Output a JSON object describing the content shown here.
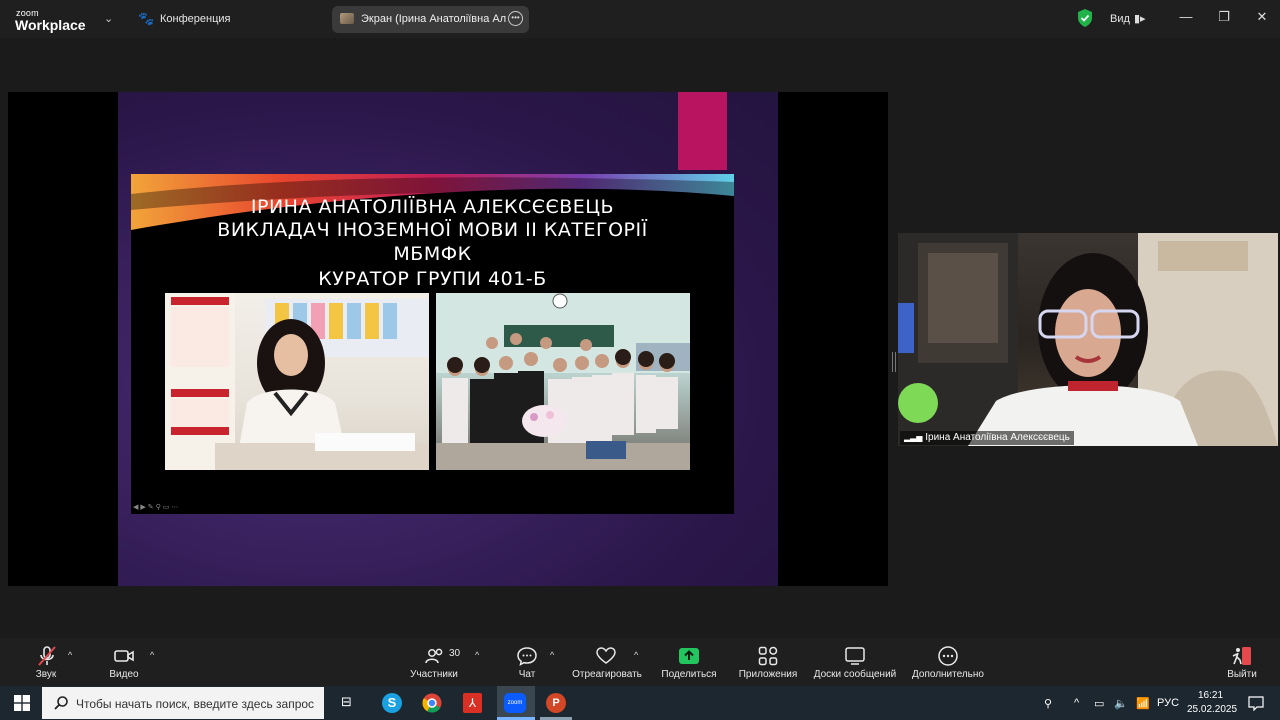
{
  "app": {
    "logo_small": "zoom",
    "logo_big": "Workplace",
    "meeting_menu": "Конференция"
  },
  "share_pill": {
    "label": "Экран (Ірина Анатоліївна Алек"
  },
  "top_right": {
    "view_label": "Вид",
    "shield_color": "#21b34a"
  },
  "slide": {
    "line1": "ІРИНА АНАТОЛІЇВНА АЛЕКСЄЄВЕЦЬ",
    "line2": "ВИКЛАДАЧ ІНОЗЕМНОЇ МОВИ ІІ КАТЕГОРІЇ",
    "line3": "МБМФК",
    "line4": "КУРАТОР ГРУПИ 401-Б",
    "accent": "#b8145f"
  },
  "participant": {
    "name": "Ірина Анатоліївна Алексєєвець"
  },
  "toolbar": {
    "audio": "Звук",
    "video": "Видео",
    "participants": "Участники",
    "participants_count": "30",
    "chat": "Чат",
    "reactions": "Отреагировать",
    "share": "Поделиться",
    "apps": "Приложения",
    "whiteboards": "Доски сообщений",
    "more": "Дополнительно",
    "leave": "Выйти",
    "share_color": "#22c55e",
    "leave_color": "#e5484d"
  },
  "taskbar": {
    "search_placeholder": "Чтобы начать поиск, введите здесь запрос",
    "lang": "РУС",
    "time": "16:21",
    "date": "25.02.2025"
  }
}
